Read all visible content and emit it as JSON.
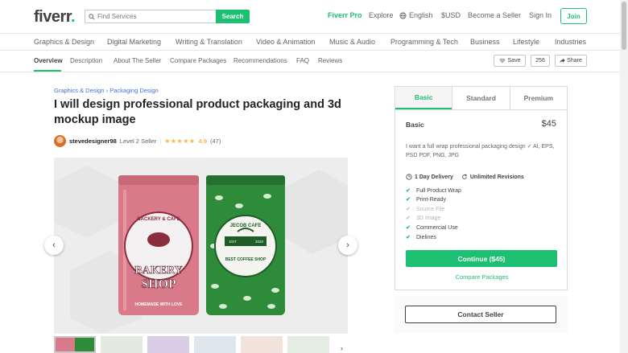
{
  "header": {
    "logo": "fiverr",
    "logo_dot": ".",
    "search_placeholder": "Find Services",
    "search_button": "Search",
    "fiverr_pro": "Fiverr Pro",
    "explore": "Explore",
    "language": "English",
    "currency": "$USD",
    "become_seller": "Become a Seller",
    "sign_in": "Sign In",
    "join": "Join"
  },
  "categories": [
    "Graphics & Design",
    "Digital Marketing",
    "Writing & Translation",
    "Video & Animation",
    "Music & Audio",
    "Programming & Tech",
    "Business",
    "Lifestyle",
    "Industries"
  ],
  "subnav": {
    "items": [
      "Overview",
      "Description",
      "About The Seller",
      "Compare Packages",
      "Recommendations",
      "FAQ",
      "Reviews"
    ],
    "save": "Save",
    "save_count": "256",
    "share": "Share"
  },
  "breadcrumb": {
    "first": "Graphics & Design",
    "sep": "›",
    "second": "Packaging Design"
  },
  "gig": {
    "title": "I will design professional product packaging and 3d mockup image",
    "seller_name": "stevedesigner98",
    "seller_level": "Level 2 Seller",
    "stars": "★★★★★",
    "rating": "4.9",
    "reviews": "(47)"
  },
  "gallery": {
    "pouch1_line1": "BACKERY & CAFE",
    "pouch1_line2": "BAKERY",
    "pouch1_line3": "SHOP",
    "pouch1_line4": "HOMEMADE WITH LOVE",
    "pouch2_line1": "JECOB CAFE",
    "pouch2_line2": "BEST COFFEE SHOP",
    "pouch2_est": "EST",
    "pouch2_year": "2020",
    "prev": "‹",
    "next": "›",
    "thumb_next": "›"
  },
  "package": {
    "tabs": [
      "Basic",
      "Standard",
      "Premium"
    ],
    "name": "Basic",
    "price": "$45",
    "description": "I want a full wrap professional packaging design ✓ AI, EPS, PSD PDF, PNG, JPG",
    "delivery": "1 Day Delivery",
    "revisions": "Unlimited Revisions",
    "features": [
      {
        "label": "Full Product Wrap",
        "included": true
      },
      {
        "label": "Print-Ready",
        "included": true
      },
      {
        "label": "Source File",
        "included": false
      },
      {
        "label": "3D Image",
        "included": false
      },
      {
        "label": "Commercial Use",
        "included": true
      },
      {
        "label": "Dielines",
        "included": true
      }
    ],
    "continue": "Continue ($45)",
    "compare": "Compare Packages"
  },
  "contact": "Contact Seller",
  "colors": {
    "brand": "#1dbf73",
    "link": "#446ee7",
    "star": "#ffb33e",
    "pink": "#d97a8a",
    "green": "#2e8b3a"
  }
}
